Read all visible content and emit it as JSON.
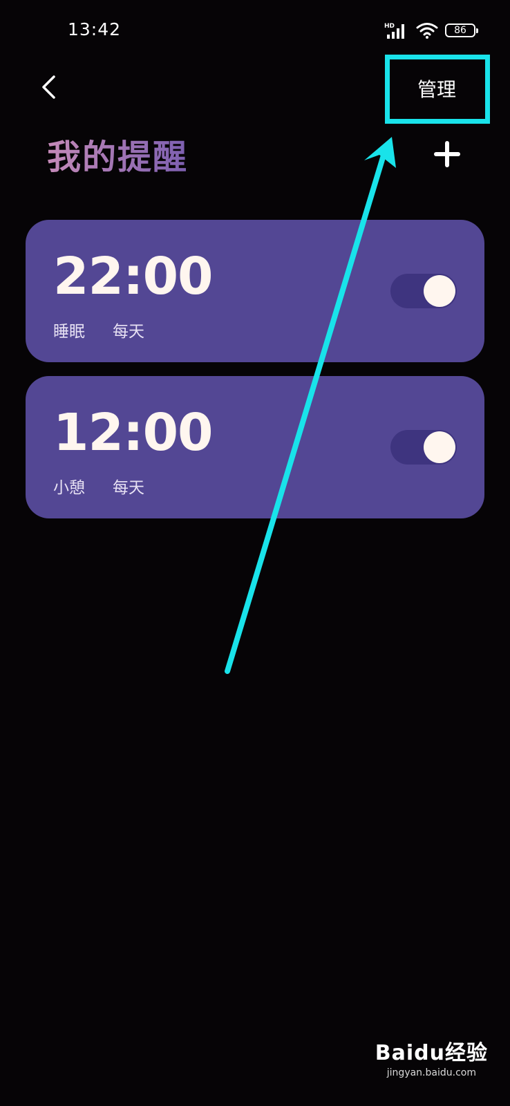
{
  "status_bar": {
    "time": "13:42",
    "network_label": "HD",
    "battery": "86",
    "icons": [
      "signal-icon",
      "wifi-icon",
      "battery-icon"
    ]
  },
  "header": {
    "back_icon": "chevron-left-icon",
    "manage_label": "管理",
    "title": "我的提醒",
    "add_icon": "plus-icon"
  },
  "reminders": [
    {
      "time": "22:00",
      "name": "睡眠",
      "repeat": "每天",
      "enabled": true
    },
    {
      "time": "12:00",
      "name": "小憩",
      "repeat": "每天",
      "enabled": true
    }
  ],
  "colors": {
    "background": "#060406",
    "card": "#534794",
    "toggle_track": "#3e347f",
    "toggle_knob": "#fff6ef",
    "annotation": "#19e3ea",
    "title_gradient_start": "#c58ab8",
    "title_gradient_end": "#7c5fb0"
  },
  "watermark": {
    "logo": "Baidu经验",
    "url": "jingyan.baidu.com"
  }
}
